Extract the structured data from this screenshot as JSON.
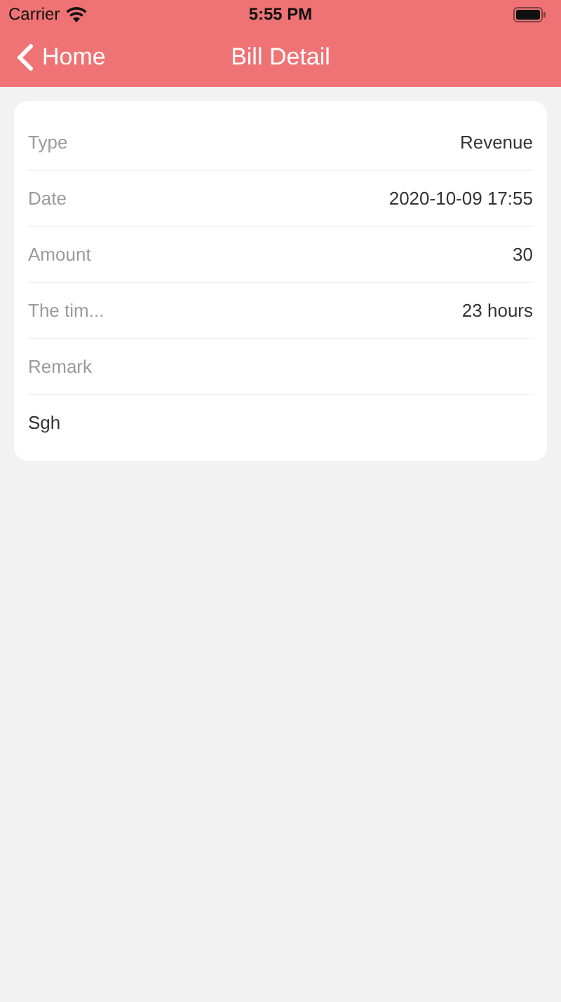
{
  "status_bar": {
    "carrier": "Carrier",
    "time": "5:55 PM"
  },
  "nav": {
    "back": "Home",
    "title": "Bill Detail"
  },
  "rows": [
    {
      "label": "Type",
      "value": "Revenue"
    },
    {
      "label": "Date",
      "value": "2020-10-09 17:55"
    },
    {
      "label": "Amount",
      "value": "30"
    },
    {
      "label": "The tim...",
      "value": "23 hours"
    },
    {
      "label": "Remark"
    }
  ],
  "remark_text": "Sgh"
}
